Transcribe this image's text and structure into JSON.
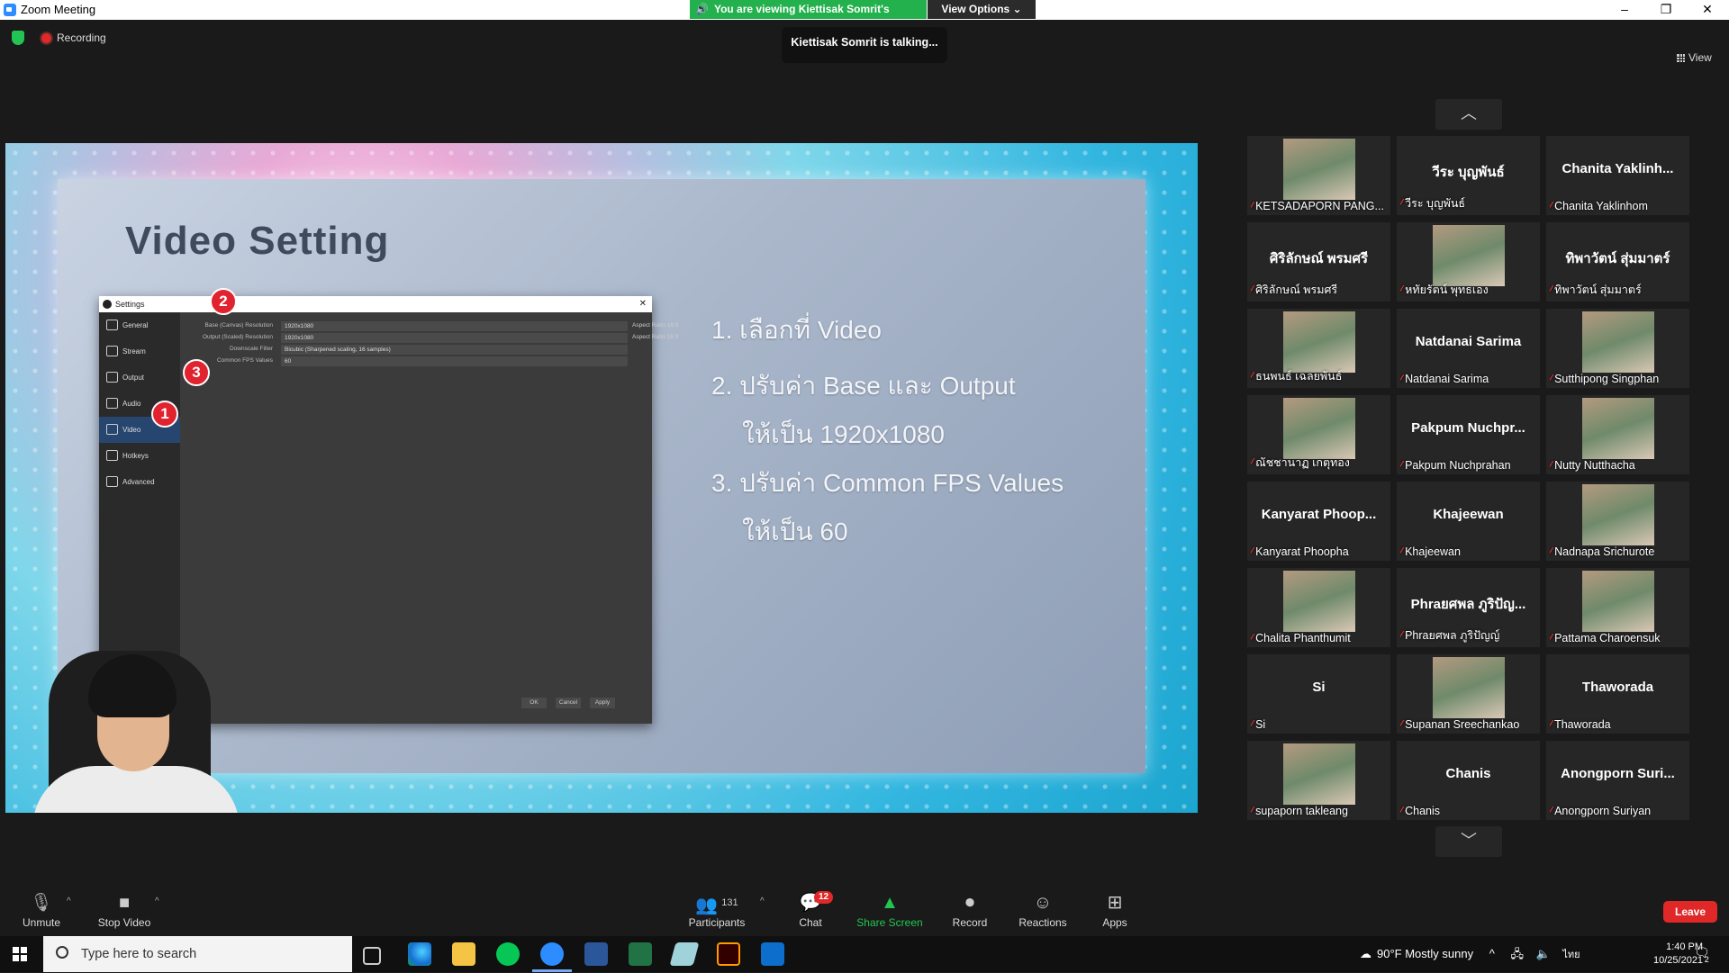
{
  "window": {
    "app_title": "Zoom Meeting",
    "share_banner": "You are viewing Kiettisak Somrit's screen",
    "view_options": "View Options ⌄",
    "minimize": "–",
    "restore": "❐",
    "close": "✕"
  },
  "top_bar": {
    "recording_label": "Recording",
    "talking_indicator": "Kiettisak Somrit is talking...",
    "view_label": "View"
  },
  "slide": {
    "title": "Video Setting",
    "steps": [
      "1. เลือกที่ Video",
      "2. ปรับค่า Base และ Output",
      "ให้เป็น 1920x1080",
      "3. ปรับค่า Common FPS Values",
      "ให้เป็น 60"
    ],
    "settings_window": {
      "title": "Settings",
      "sidebar": [
        "General",
        "Stream",
        "Output",
        "Audio",
        "Video",
        "Hotkeys",
        "Advanced"
      ],
      "active_item": "Video",
      "rows": [
        {
          "label": "Base (Canvas) Resolution",
          "value": "1920x1080",
          "aspect": "Aspect Ratio 16:9"
        },
        {
          "label": "Output (Scaled) Resolution",
          "value": "1920x1080",
          "aspect": "Aspect Ratio 16:9"
        },
        {
          "label": "Downscale Filter",
          "value": "Bicubic (Sharpened scaling, 16 samples)",
          "aspect": ""
        },
        {
          "label": "Common FPS Values",
          "value": "60",
          "aspect": ""
        }
      ],
      "buttons": [
        "OK",
        "Cancel",
        "Apply"
      ],
      "badges": [
        "1",
        "2",
        "3"
      ]
    }
  },
  "gallery": {
    "up_arrow": "︿",
    "down_arrow": "﹀",
    "tiles": [
      {
        "display": "",
        "name": "KETSADAPORN PANG...",
        "has_photo": true
      },
      {
        "display": "วีระ บุญพันธ์",
        "name": "วีระ บุญพันธ์",
        "has_photo": false
      },
      {
        "display": "Chanita  Yaklinh...",
        "name": "Chanita Yaklinhom",
        "has_photo": false
      },
      {
        "display": "ศิริลักษณ์ พรมศรี",
        "name": "ศิริลักษณ์ พรมศรี",
        "has_photo": false
      },
      {
        "display": "",
        "name": "หทัยรัตน์ พุทธเอง",
        "has_photo": true
      },
      {
        "display": "ทิพาวัตน์ สุ่มมาตร์",
        "name": "ทิพาวัตน์ สุ่มมาตร์",
        "has_photo": false
      },
      {
        "display": "",
        "name": "ธนพนธ์ เฉลยพันธ์",
        "has_photo": true
      },
      {
        "display": "Natdanai Sarima",
        "name": "Natdanai Sarima",
        "has_photo": false
      },
      {
        "display": "",
        "name": "Sutthipong Singphan",
        "has_photo": true
      },
      {
        "display": "",
        "name": "ณัชชานาฏ เกตุทอง",
        "has_photo": true
      },
      {
        "display": "Pakpum  Nuchpr...",
        "name": "Pakpum Nuchprahan",
        "has_photo": false
      },
      {
        "display": "",
        "name": "Nutty Nutthacha",
        "has_photo": true
      },
      {
        "display": "Kanyarat  Phoop...",
        "name": "Kanyarat Phoopha",
        "has_photo": false
      },
      {
        "display": "Khajeewan",
        "name": "Khajeewan",
        "has_photo": false
      },
      {
        "display": "",
        "name": "Nadnapa Srichurote",
        "has_photo": true
      },
      {
        "display": "",
        "name": "Chalita Phanthumit",
        "has_photo": true
      },
      {
        "display": "Phraยศพล ภูริปัญ...",
        "name": "Phraยศพล ภูริปัญญ์",
        "has_photo": false
      },
      {
        "display": "",
        "name": "Pattama Charoensuk",
        "has_photo": true
      },
      {
        "display": "Si",
        "name": "Si",
        "has_photo": false
      },
      {
        "display": "",
        "name": "Supanan Sreechankao",
        "has_photo": true
      },
      {
        "display": "Thaworada",
        "name": "Thaworada",
        "has_photo": false
      },
      {
        "display": "",
        "name": "supaporn takleang",
        "has_photo": true
      },
      {
        "display": "Chanis",
        "name": "Chanis",
        "has_photo": false
      },
      {
        "display": "Anongporn  Suri...",
        "name": "Anongporn Suriyan",
        "has_photo": false
      }
    ]
  },
  "toolbar": {
    "unmute": "Unmute",
    "stop_video": "Stop Video",
    "participants": "Participants",
    "participants_count": "131",
    "chat": "Chat",
    "chat_badge": "12",
    "share_screen": "Share Screen",
    "record": "Record",
    "reactions": "Reactions",
    "apps": "Apps",
    "leave": "Leave",
    "share_color": "#23c552",
    "leave_color": "#e02828"
  },
  "taskbar": {
    "search_placeholder": "Type here to search",
    "weather": "90°F  Mostly sunny",
    "language": "ไทย",
    "time": "1:40 PM",
    "date": "10/25/2021",
    "notifications": "2",
    "apps": [
      "task-view-icon",
      "edge-icon",
      "file-explorer-icon",
      "line-icon",
      "zoom-icon",
      "word-icon",
      "excel-icon",
      "feather-icon",
      "illustrator-icon",
      "photos-icon"
    ]
  }
}
